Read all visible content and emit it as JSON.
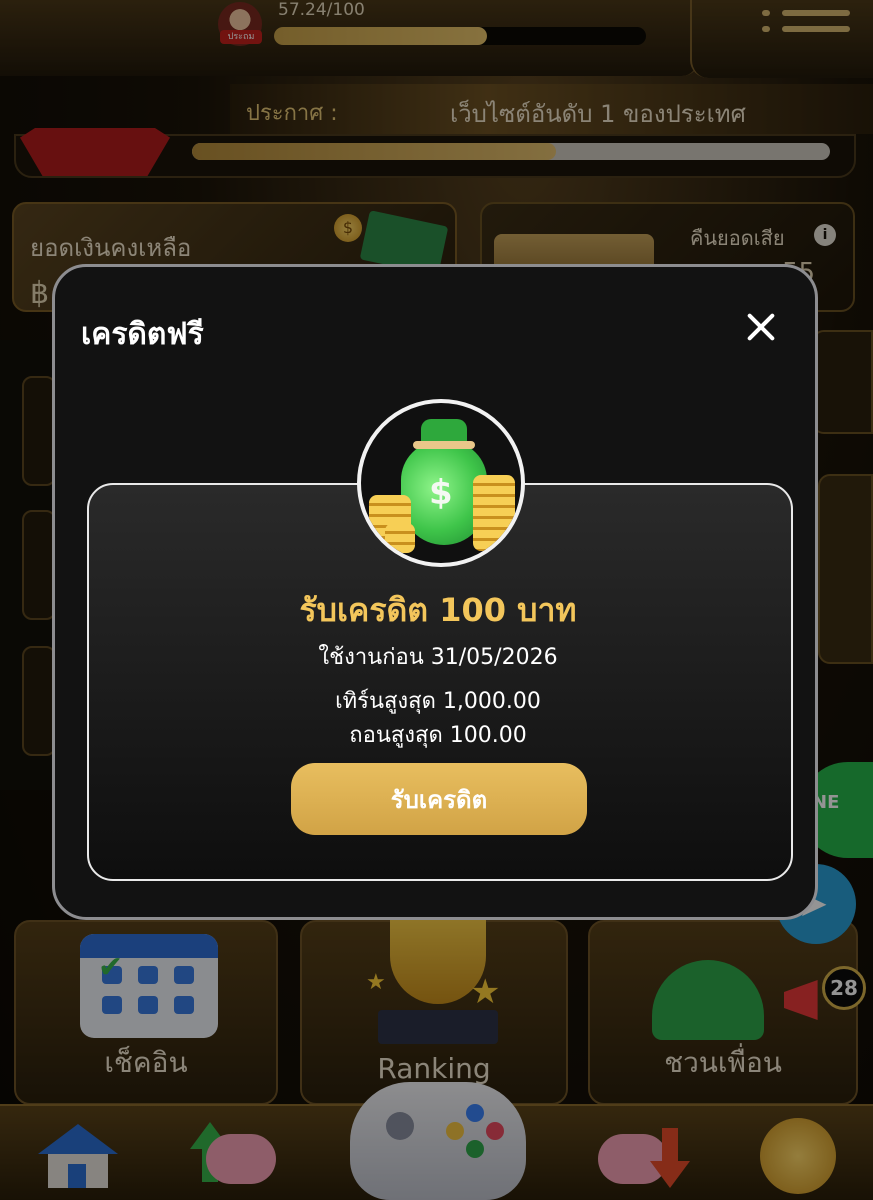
{
  "header": {
    "level_progress_text": "57.24/100",
    "level_progress": 0.5724,
    "avatar_tag": "ประถม"
  },
  "announcement": {
    "label": "ประกาศ :",
    "text": "เว็บไซต์อันดับ 1 ของประเทศ"
  },
  "rank": {
    "progress": 0.57
  },
  "balance": {
    "label": "ยอดเงินคงเหลือ",
    "currency_symbol": "฿"
  },
  "cashback": {
    "label": "คืนยอดเสีย",
    "value": "55"
  },
  "tiles": [
    {
      "label": "เช็คอิน",
      "icon": "calendar-icon"
    },
    {
      "label": "Ranking",
      "icon": "trophy-icon"
    },
    {
      "label": "ชวนเพื่อน",
      "icon": "invite-friend-icon"
    }
  ],
  "floating": {
    "line_label": "NE",
    "notification_count": "28"
  },
  "bottom_nav": [
    {
      "icon": "home-icon"
    },
    {
      "icon": "deposit-icon"
    },
    {
      "icon": "game-controller-icon"
    },
    {
      "icon": "withdraw-icon"
    },
    {
      "icon": "gift-coin-icon"
    }
  ],
  "modal": {
    "title": "เครดิตฟรี",
    "reward_title": "รับเครดิต 100 บาท",
    "expire_text": "ใช้งานก่อน 31/05/2026",
    "turnover_text": "เทิร์นสูงสุด 1,000.00",
    "withdraw_text": "ถอนสูงสุด 100.00",
    "claim_button": "รับเครดิต",
    "icon": "money-bag-icon"
  },
  "colors": {
    "accent_gold": "#e8be5f",
    "reward_title": "#f3c65b",
    "modal_bg": "#121212"
  }
}
